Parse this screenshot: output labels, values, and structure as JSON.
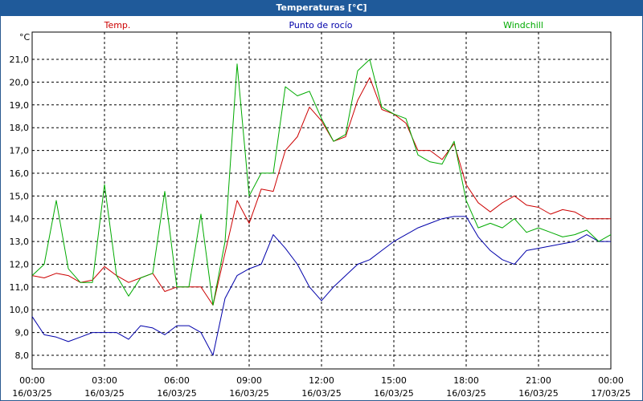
{
  "window": {
    "title": "Temperaturas [°C]"
  },
  "chart_data": {
    "type": "line",
    "title": "Temperaturas [°C]",
    "ylabel": "°C",
    "xlabel": "",
    "ylim": [
      7.4,
      22.2
    ],
    "xlim": [
      "16/03/25 00:00",
      "17/03/25 00:00"
    ],
    "grid": true,
    "legend_position": "top",
    "y_ticks": [
      8,
      9,
      10,
      11,
      12,
      13,
      14,
      15,
      16,
      17,
      18,
      19,
      20,
      21
    ],
    "y_tick_labels": [
      "8,0",
      "9,0",
      "10,0",
      "11,0",
      "12,0",
      "13,0",
      "14,0",
      "15,0",
      "16,0",
      "17,0",
      "18,0",
      "19,0",
      "20,0",
      "21,0"
    ],
    "x_ticks": [
      {
        "time": "00:00",
        "date": "16/03/25"
      },
      {
        "time": "03:00",
        "date": "16/03/25"
      },
      {
        "time": "06:00",
        "date": "16/03/25"
      },
      {
        "time": "09:00",
        "date": "16/03/25"
      },
      {
        "time": "12:00",
        "date": "16/03/25"
      },
      {
        "time": "15:00",
        "date": "16/03/25"
      },
      {
        "time": "18:00",
        "date": "16/03/25"
      },
      {
        "time": "21:00",
        "date": "16/03/25"
      },
      {
        "time": "00:00",
        "date": "17/03/25"
      }
    ],
    "x": [
      "16/03/25 00:00",
      "16/03/25 00:30",
      "16/03/25 01:00",
      "16/03/25 01:30",
      "16/03/25 02:00",
      "16/03/25 02:30",
      "16/03/25 03:00",
      "16/03/25 03:30",
      "16/03/25 04:00",
      "16/03/25 04:30",
      "16/03/25 05:00",
      "16/03/25 05:30",
      "16/03/25 06:00",
      "16/03/25 06:30",
      "16/03/25 07:00",
      "16/03/25 07:30",
      "16/03/25 08:00",
      "16/03/25 08:30",
      "16/03/25 09:00",
      "16/03/25 09:30",
      "16/03/25 10:00",
      "16/03/25 10:30",
      "16/03/25 11:00",
      "16/03/25 11:30",
      "16/03/25 12:00",
      "16/03/25 12:30",
      "16/03/25 13:00",
      "16/03/25 13:30",
      "16/03/25 14:00",
      "16/03/25 14:30",
      "16/03/25 15:00",
      "16/03/25 15:30",
      "16/03/25 16:00",
      "16/03/25 16:30",
      "16/03/25 17:00",
      "16/03/25 17:30",
      "16/03/25 18:00",
      "16/03/25 18:30",
      "16/03/25 19:00",
      "16/03/25 19:30",
      "16/03/25 20:00",
      "16/03/25 20:30",
      "16/03/25 21:00",
      "16/03/25 21:30",
      "16/03/25 22:00",
      "16/03/25 22:30",
      "16/03/25 23:00",
      "16/03/25 23:30",
      "17/03/25 00:00"
    ],
    "series": [
      {
        "name": "Temp.",
        "color": "#cc0000",
        "values": [
          11.5,
          11.4,
          11.6,
          11.5,
          11.2,
          11.3,
          11.9,
          11.5,
          11.2,
          11.4,
          11.6,
          10.8,
          11.0,
          11.0,
          11.0,
          10.2,
          12.5,
          14.8,
          13.8,
          15.3,
          15.2,
          17.0,
          17.6,
          18.9,
          18.3,
          17.4,
          17.6,
          19.2,
          20.2,
          18.8,
          18.6,
          18.2,
          17.0,
          17.0,
          16.6,
          17.3,
          15.5,
          14.7,
          14.3,
          14.7,
          15.0,
          14.6,
          14.5,
          14.2,
          14.4,
          14.3,
          14.0,
          14.0,
          14.0
        ]
      },
      {
        "name": "Punto de rocío",
        "color": "#0000aa",
        "values": [
          9.7,
          8.9,
          8.8,
          8.6,
          8.8,
          9.0,
          9.0,
          9.0,
          8.7,
          9.3,
          9.2,
          8.9,
          9.3,
          9.3,
          9.0,
          8.0,
          10.5,
          11.5,
          11.8,
          12.0,
          13.3,
          12.7,
          12.0,
          11.0,
          10.4,
          11.0,
          11.5,
          12.0,
          12.2,
          12.6,
          13.0,
          13.3,
          13.6,
          13.8,
          14.0,
          14.1,
          14.1,
          13.2,
          12.6,
          12.2,
          12.0,
          12.6,
          12.7,
          12.8,
          12.9,
          13.0,
          13.3,
          13.0,
          13.0
        ]
      },
      {
        "name": "Windchill",
        "color": "#00aa00",
        "values": [
          11.5,
          12.0,
          14.8,
          11.8,
          11.2,
          11.2,
          15.5,
          11.5,
          10.6,
          11.4,
          11.6,
          15.2,
          11.0,
          11.0,
          14.2,
          10.2,
          13.0,
          20.8,
          15.0,
          16.0,
          16.0,
          19.8,
          19.4,
          19.6,
          18.4,
          17.4,
          17.7,
          20.5,
          21.0,
          18.9,
          18.6,
          18.4,
          16.8,
          16.5,
          16.4,
          17.4,
          14.8,
          13.6,
          13.8,
          13.6,
          14.0,
          13.4,
          13.6,
          13.4,
          13.2,
          13.3,
          13.5,
          13.0,
          13.3
        ]
      }
    ]
  }
}
